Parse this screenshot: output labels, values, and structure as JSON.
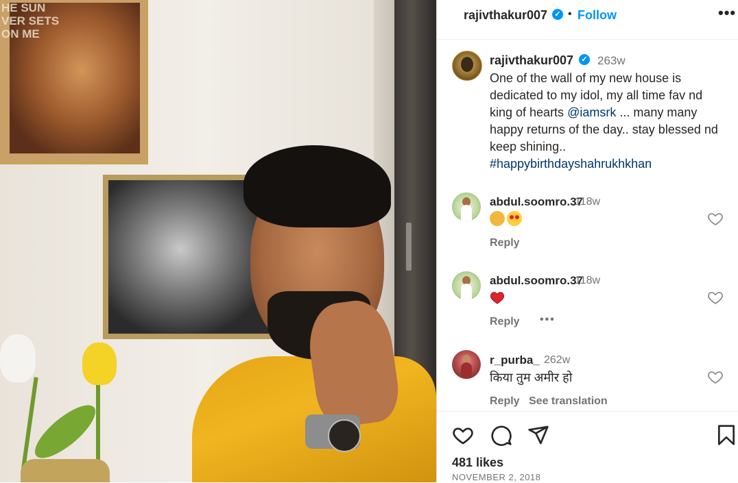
{
  "post": {
    "username": "rajivthakur007",
    "dot": "•",
    "follow_label": "Follow",
    "more_label": "•••",
    "caption": {
      "username": "rajivthakur007",
      "time": "263w",
      "text_part1": "One of the wall of my new house is dedicated to my idol, my all time fav nd king of hearts ",
      "mention": "@iamsrk",
      "text_part2": " ... many many happy returns of the day.. stay blessed nd keep shining..",
      "hashtag": "#happybirthdayshahrukhkhan"
    }
  },
  "comments": [
    {
      "username": "abdul.soomro.37",
      "time": "118w",
      "emojis": [
        "clapping-hands",
        "heart-eyes"
      ],
      "reply_label": "Reply"
    },
    {
      "username": "abdul.soomro.37",
      "time": "118w",
      "emojis": [
        "red-heart"
      ],
      "reply_label": "Reply",
      "more_label": "•••"
    },
    {
      "username": "r_purba_",
      "time": "262w",
      "text": "किया तुम अमीर हो",
      "reply_label": "Reply",
      "translation_label": "See translation"
    }
  ],
  "footer": {
    "likes": "481 likes",
    "date": "NOVEMBER 2, 2018"
  },
  "photo_poster_text": "HE SUN\nVER SETS\nON ME",
  "colors": {
    "accent": "#0095f6",
    "link": "#00376b",
    "muted": "#737373"
  },
  "icons": [
    "verified-icon",
    "more-options-icon",
    "heart-icon",
    "comment-icon",
    "share-icon",
    "bookmark-icon"
  ]
}
